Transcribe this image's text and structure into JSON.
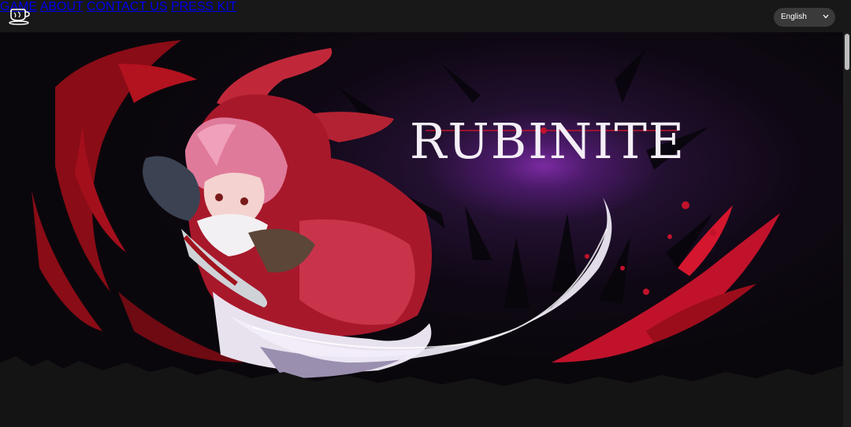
{
  "nav": {
    "items": [
      {
        "label": "GAME"
      },
      {
        "label": "ABOUT"
      },
      {
        "label": "CONTACT US"
      },
      {
        "label": "PRESS KIT"
      }
    ],
    "language": {
      "selected": "English"
    }
  },
  "hero": {
    "game_title": "RUBINITE",
    "colors": {
      "accent": "#c1122b",
      "glow": "#7a2aa0",
      "background": "#0a070c"
    }
  },
  "icons": {
    "logo": "teacup-logo-icon",
    "language_chevron": "chevron-down-icon"
  }
}
